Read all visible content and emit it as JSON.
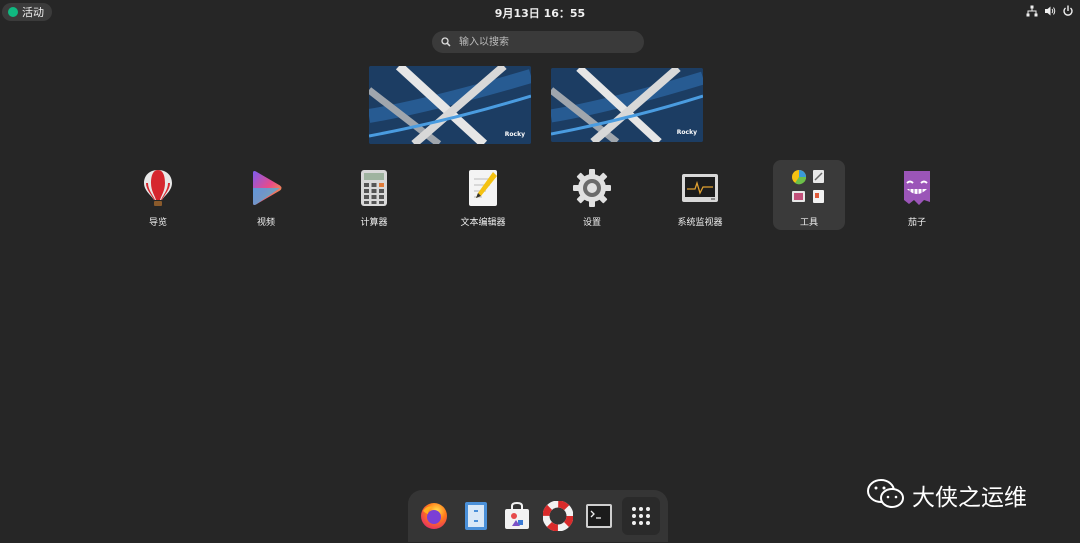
{
  "topbar": {
    "activities_label": "活动",
    "clock": "9月13日  16：55",
    "tray_icons": [
      "network-icon",
      "volume-icon",
      "power-icon"
    ]
  },
  "search": {
    "placeholder": "输入以搜索"
  },
  "workspaces": [
    {
      "brand": "Rocky"
    },
    {
      "brand": "Rocky"
    }
  ],
  "apps": [
    {
      "label": "导览",
      "icon": "hot-air-balloon-icon"
    },
    {
      "label": "视频",
      "icon": "video-play-icon"
    },
    {
      "label": "计算器",
      "icon": "calculator-icon"
    },
    {
      "label": "文本编辑器",
      "icon": "text-editor-icon"
    },
    {
      "label": "设置",
      "icon": "gear-icon"
    },
    {
      "label": "系统监视器",
      "icon": "system-monitor-icon"
    },
    {
      "label": "工具",
      "icon": "tools-folder-icon",
      "selected": true
    },
    {
      "label": "茄子",
      "icon": "cheese-icon"
    }
  ],
  "dock": [
    {
      "icon": "firefox-icon"
    },
    {
      "icon": "files-icon"
    },
    {
      "icon": "software-center-icon"
    },
    {
      "icon": "help-lifebuoy-icon"
    },
    {
      "icon": "terminal-icon"
    },
    {
      "icon": "show-apps-grid-icon"
    }
  ],
  "watermark": {
    "text": "大侠之运维"
  },
  "colors": {
    "background": "#262626",
    "accent": "#10b981",
    "selection": "#3a3a3a"
  }
}
